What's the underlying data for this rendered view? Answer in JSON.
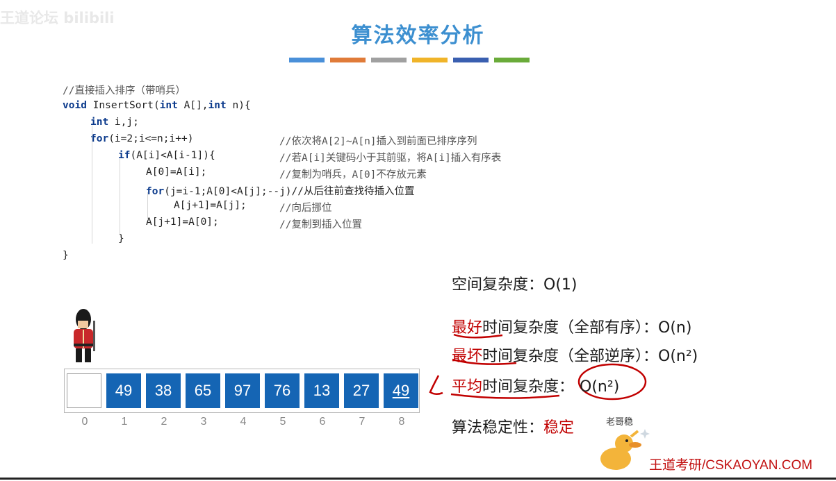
{
  "slide": {
    "title": "算法效率分析",
    "watermark": "王道论坛 bilibili",
    "title_bar_colors": [
      "#4a90d9",
      "#e07b39",
      "#a0a0a0",
      "#f0b429",
      "#3a5fb0",
      "#6aab3a"
    ]
  },
  "code": {
    "lines": [
      {
        "parts": [
          {
            "t": "//直接插入排序（带哨兵）",
            "c": "cm"
          }
        ]
      },
      {
        "parts": [
          {
            "t": "void",
            "c": "kw"
          },
          {
            "t": " InsertSort("
          },
          {
            "t": "int",
            "c": "kw"
          },
          {
            "t": " A[],"
          },
          {
            "t": "int",
            "c": "kw"
          },
          {
            "t": " n){"
          }
        ]
      },
      {
        "parts": [
          {
            "t": "int",
            "c": "kw"
          },
          {
            "t": " i,j;"
          }
        ]
      },
      {
        "parts": [
          {
            "t": "for",
            "c": "kw"
          },
          {
            "t": "(i=2;i<=n;i++)"
          }
        ],
        "comment": "//依次将A[2]~A[n]插入到前面已排序序列"
      },
      {
        "parts": [
          {
            "t": "if",
            "c": "kw"
          },
          {
            "t": "(A[i]<A[i-1]){"
          }
        ],
        "comment": "//若A[i]关键码小于其前驱，将A[i]插入有序表"
      },
      {
        "parts": [
          {
            "t": "A[0]=A[i];"
          }
        ],
        "comment": "//复制为哨兵，A[0]不存放元素"
      },
      {
        "parts": [
          {
            "t": "for",
            "c": "kw"
          },
          {
            "t": "(j=i-1;A[0]<A[j];--j)//从后往前查找待插入位置"
          }
        ]
      },
      {
        "parts": [
          {
            "t": "A[j+1]=A[j];"
          }
        ],
        "comment": "//向后挪位"
      },
      {
        "parts": [
          {
            "t": "A[j+1]=A[0];"
          }
        ],
        "comment": "//复制到插入位置"
      },
      {
        "parts": [
          {
            "t": "}"
          }
        ]
      },
      {
        "parts": [
          {
            "t": "}"
          }
        ]
      }
    ]
  },
  "array": {
    "cells": [
      "",
      "49",
      "38",
      "65",
      "97",
      "76",
      "13",
      "27",
      "49"
    ],
    "indices": [
      "0",
      "1",
      "2",
      "3",
      "4",
      "5",
      "6",
      "7",
      "8"
    ],
    "fill_color": "#1565b4"
  },
  "complexity": {
    "space": "空间复杂度：O(1)",
    "best_prefix": "最好",
    "best_rest": "时间复杂度（全部有序）：O(n)",
    "worst_prefix": "最坏",
    "worst_rest": "时间复杂度（全部逆序）：O(n²)",
    "avg_prefix": "平均",
    "avg_rest": "时间复杂度：",
    "avg_value": "O(n²)",
    "stability_label": "算法稳定性：",
    "stability_value": "稳定",
    "accent_red": "#c10000"
  },
  "duck_label": "老哥稳",
  "site": "王道考研/CSKAOYAN.COM"
}
